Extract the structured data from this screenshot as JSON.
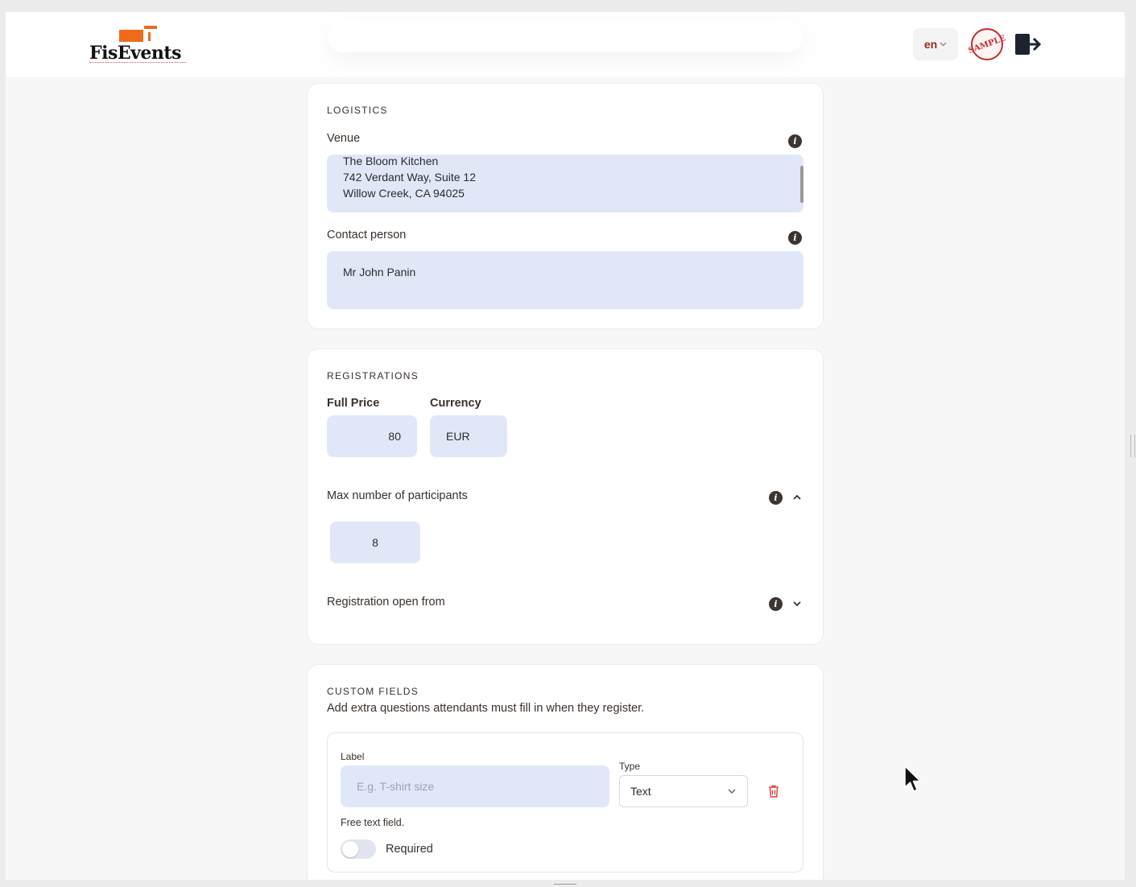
{
  "header": {
    "logo_text": "FisEvents",
    "language": "en",
    "avatar_text": "SAMPLE"
  },
  "logistics": {
    "title": "LOGISTICS",
    "venue_label": "Venue",
    "venue_lines": [
      "The Bloom Kitchen",
      "742 Verdant Way, Suite 12",
      "Willow Creek, CA 94025"
    ],
    "contact_label": "Contact person",
    "contact_value": "Mr John Panin"
  },
  "registrations": {
    "title": "REGISTRATIONS",
    "price_label": "Full Price",
    "price_value": "80",
    "currency_label": "Currency",
    "currency_value": "EUR",
    "max_label": "Max number of participants",
    "max_value": "8",
    "open_from_label": "Registration open from"
  },
  "custom_fields": {
    "title": "CUSTOM FIELDS",
    "description": "Add extra questions attendants must fill in when they register.",
    "label_label": "Label",
    "label_placeholder": "E.g. T-shirt size",
    "type_label": "Type",
    "type_value": "Text",
    "hint": "Free text field.",
    "required_label": "Required",
    "required_on": false
  },
  "colors": {
    "accent": "#f06a1c",
    "field_bg": "#e0e8f8",
    "delete": "#e0413a"
  },
  "icons": [
    "info-icon",
    "chevron-up-icon",
    "chevron-down-icon",
    "trash-icon",
    "logout-icon",
    "mouse-cursor-icon"
  ]
}
